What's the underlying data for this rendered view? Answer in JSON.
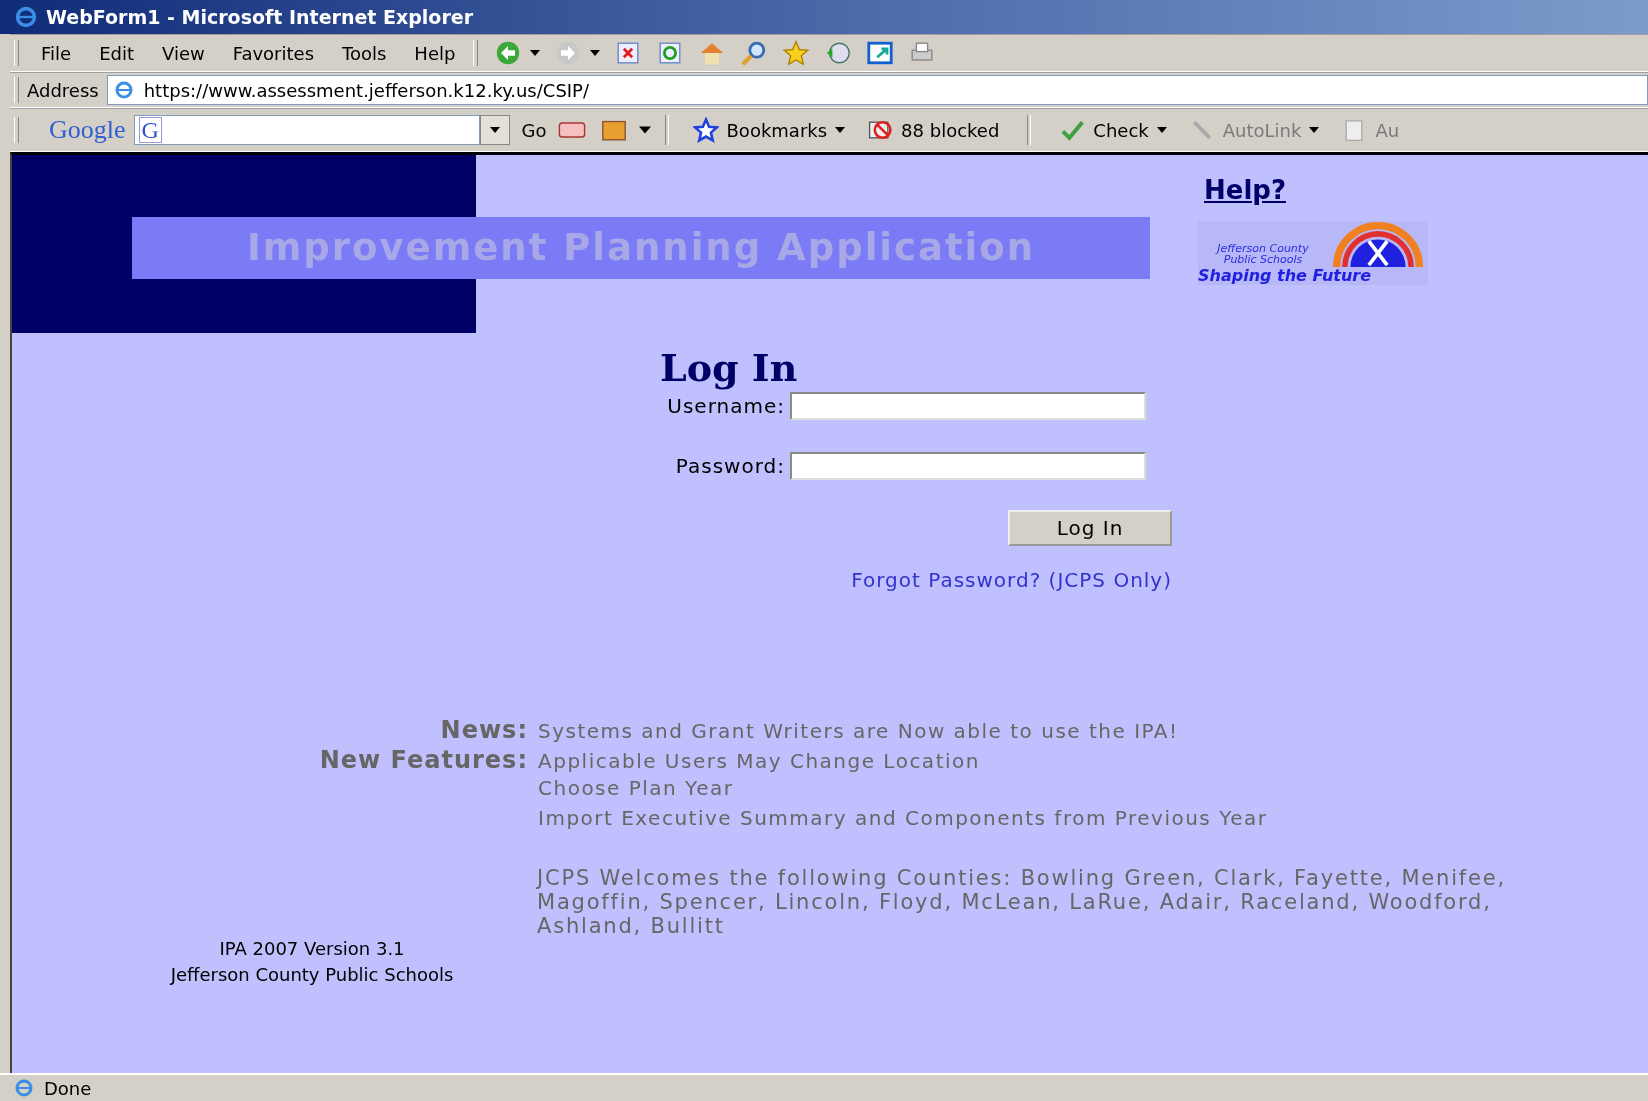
{
  "window": {
    "title": "WebForm1 - Microsoft Internet Explorer"
  },
  "menu": [
    "File",
    "Edit",
    "View",
    "Favorites",
    "Tools",
    "Help"
  ],
  "address": {
    "label": "Address",
    "value": "https://www.assessment.jefferson.k12.ky.us/CSIP/"
  },
  "google_toolbar": {
    "logo": "Google",
    "search_glyph": "G",
    "go": "Go",
    "items": [
      {
        "label": "Bookmarks",
        "disabled": false
      },
      {
        "label": "88 blocked",
        "disabled": false
      },
      {
        "label": "Check",
        "disabled": false
      },
      {
        "label": "AutoLink",
        "disabled": true
      },
      {
        "label": "Au",
        "disabled": true
      }
    ]
  },
  "page": {
    "banner": "Improvement Planning Application",
    "help_link": "Help?",
    "logo": {
      "line1": "Jefferson County",
      "line2": "Public Schools",
      "tagline": "Shaping the Future"
    },
    "login": {
      "title": "Log In",
      "fields": [
        {
          "label": "Username:"
        },
        {
          "label": "Password:"
        }
      ],
      "button": "Log In",
      "forgot_link": "Forgot Password? (JCPS Only)"
    },
    "news": [
      {
        "label": "News:",
        "lines": [
          "Systems and Grant Writers are Now able to use the IPA!"
        ]
      },
      {
        "label": "New Features:",
        "lines": [
          "Applicable Users May Change Location",
          "Choose Plan Year",
          "Import Executive Summary and Components from Previous Year"
        ]
      }
    ],
    "welcome": "JCPS Welcomes the following Counties: Bowling Green, Clark, Fayette, Menifee, Magoffin, Spencer, Lincoln, Floyd, McLean, LaRue, Adair, Raceland, Woodford, Ashland, Bullitt",
    "footer": [
      "IPA 2007 Version 3.1",
      "Jefferson County Public Schools"
    ]
  },
  "status_bar": {
    "text": "Done"
  }
}
